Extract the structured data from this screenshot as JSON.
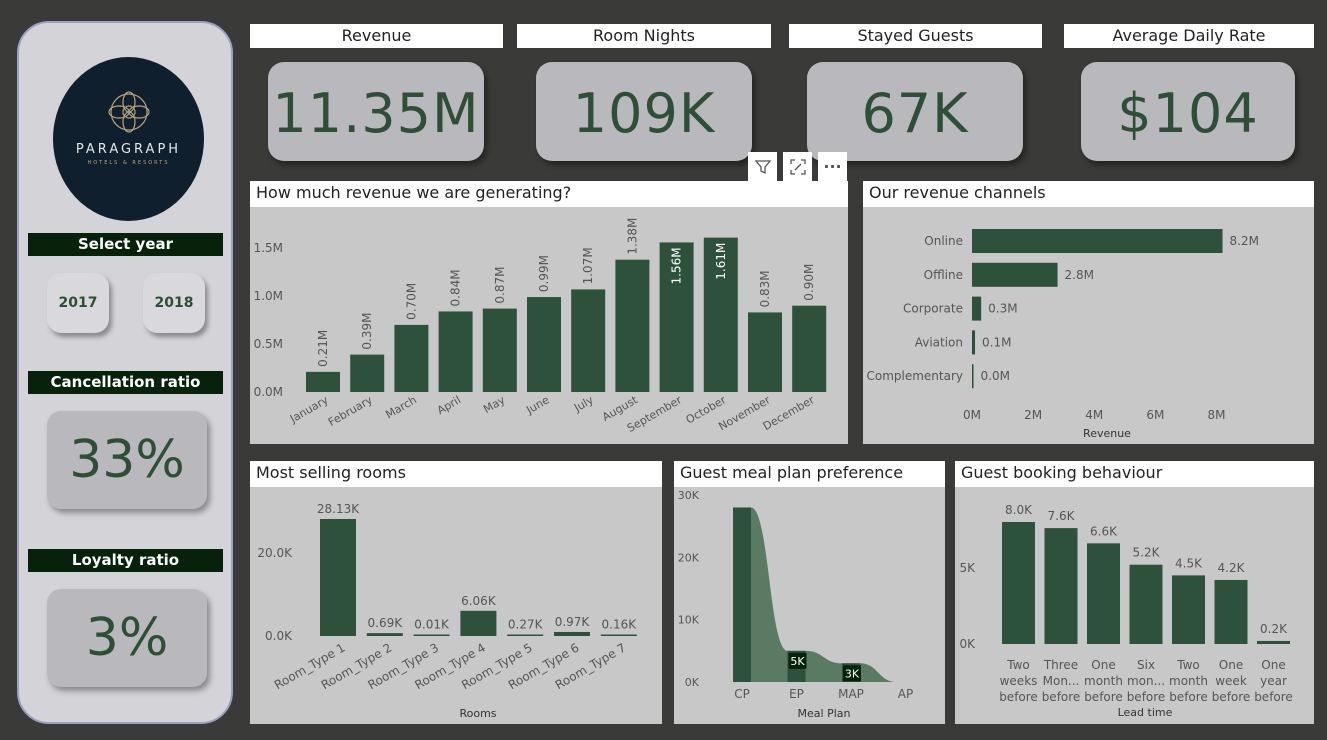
{
  "brand": {
    "name": "PARAGRAPH",
    "tagline": "HOTELS & RESORTS"
  },
  "filters": {
    "label": "Select year",
    "years": [
      "2017",
      "2018"
    ]
  },
  "cancellation": {
    "label": "Cancellation ratio",
    "value": "33%"
  },
  "loyalty": {
    "label": "Loyalty ratio",
    "value": "3%"
  },
  "kpis": [
    {
      "title": "Revenue",
      "value": "11.35M"
    },
    {
      "title": "Room Nights",
      "value": "109K"
    },
    {
      "title": "Stayed Guests",
      "value": "67K"
    },
    {
      "title": "Average Daily Rate",
      "value": "$104"
    }
  ],
  "toolbar": {
    "more_label": "···"
  },
  "colors": {
    "bar": "#2e513b",
    "area": "#5b7a63",
    "label_bg": "#06220b",
    "panel": "#c8c8c8"
  },
  "chart_data": [
    {
      "id": "monthly_revenue",
      "type": "bar",
      "title": "How much revenue we are generating?",
      "categories": [
        "January",
        "February",
        "March",
        "April",
        "May",
        "June",
        "July",
        "August",
        "September",
        "October",
        "November",
        "December"
      ],
      "values": [
        0.21,
        0.39,
        0.7,
        0.84,
        0.87,
        0.99,
        1.07,
        1.38,
        1.56,
        1.61,
        0.83,
        0.9
      ],
      "data_labels": [
        "0.21M",
        "0.39M",
        "0.70M",
        "0.84M",
        "0.87M",
        "0.99M",
        "1.07M",
        "1.38M",
        "1.56M",
        "1.61M",
        "0.83M",
        "0.90M"
      ],
      "yticks": [
        0,
        0.5,
        1.0,
        1.5
      ],
      "ytick_labels": [
        "0.0M",
        "0.5M",
        "1.0M",
        "1.5M"
      ],
      "ylim": [
        0,
        1.7
      ]
    },
    {
      "id": "revenue_channels",
      "type": "bar",
      "orientation": "horizontal",
      "title": "Our revenue channels",
      "categories": [
        "Online",
        "Offline",
        "Corporate",
        "Aviation",
        "Complementary"
      ],
      "values": [
        8.2,
        2.8,
        0.3,
        0.1,
        0.0
      ],
      "data_labels": [
        "8.2M",
        "2.8M",
        "0.3M",
        "0.1M",
        "0.0M"
      ],
      "xticks": [
        0,
        2,
        4,
        6,
        8
      ],
      "xtick_labels": [
        "0M",
        "2M",
        "4M",
        "6M",
        "8M"
      ],
      "xlim": [
        0,
        9
      ],
      "xlabel": "Revenue"
    },
    {
      "id": "room_types",
      "type": "bar",
      "title": "Most selling rooms",
      "categories": [
        "Room_Type 1",
        "Room_Type 2",
        "Room_Type 3",
        "Room_Type 4",
        "Room_Type 5",
        "Room_Type 6",
        "Room_Type 7"
      ],
      "values": [
        28.13,
        0.69,
        0.01,
        6.06,
        0.27,
        0.97,
        0.16
      ],
      "data_labels": [
        "28.13K",
        "0.69K",
        "0.01K",
        "6.06K",
        "0.27K",
        "0.97K",
        "0.16K"
      ],
      "yticks": [
        0,
        20
      ],
      "ytick_labels": [
        "0.0K",
        "20.0K"
      ],
      "ylim": [
        0,
        30
      ],
      "xlabel": "Rooms"
    },
    {
      "id": "meal_plan",
      "type": "bar",
      "title": "Guest meal plan preference",
      "categories": [
        "CP",
        "EP",
        "MAP",
        "AP"
      ],
      "values": [
        28,
        5,
        3,
        0
      ],
      "data_labels": [
        "",
        "5K",
        "3K",
        ""
      ],
      "yticks": [
        0,
        10,
        20,
        30
      ],
      "ytick_labels": [
        "0K",
        "10K",
        "20K",
        "30K"
      ],
      "ylim": [
        0,
        30
      ],
      "xlabel": "Meal Plan"
    },
    {
      "id": "lead_time",
      "type": "bar",
      "title": "Guest booking behaviour",
      "categories": [
        [
          "Two",
          "weeks",
          "before"
        ],
        [
          "Three",
          "Mon...",
          "before"
        ],
        [
          "One",
          "month",
          "before"
        ],
        [
          "Six",
          "mon...",
          "before"
        ],
        [
          "Two",
          "month",
          "before"
        ],
        [
          "One",
          "week",
          "before"
        ],
        [
          "One",
          "year",
          "before"
        ]
      ],
      "values": [
        8.0,
        7.6,
        6.6,
        5.2,
        4.5,
        4.2,
        0.2
      ],
      "data_labels": [
        "8.0K",
        "7.6K",
        "6.6K",
        "5.2K",
        "4.5K",
        "4.2K",
        "0.2K"
      ],
      "yticks": [
        0,
        5
      ],
      "ytick_labels": [
        "0K",
        "5K"
      ],
      "ylim": [
        0,
        9
      ],
      "xlabel": "Lead time"
    }
  ]
}
